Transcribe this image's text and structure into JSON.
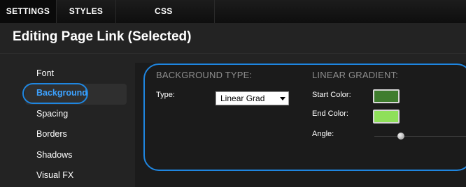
{
  "tabs": [
    {
      "label": "SETTINGS"
    },
    {
      "label": "STYLES"
    },
    {
      "label": "CSS"
    }
  ],
  "page_title": "Editing Page Link (Selected)",
  "sidebar": {
    "items": [
      {
        "label": "Font"
      },
      {
        "label": "Background"
      },
      {
        "label": "Spacing"
      },
      {
        "label": "Borders"
      },
      {
        "label": "Shadows"
      },
      {
        "label": "Visual FX"
      }
    ],
    "selected": "Background"
  },
  "background_type": {
    "heading": "BACKGROUND TYPE:",
    "type_label": "Type:",
    "type_value": "Linear Grad"
  },
  "linear_gradient": {
    "heading": "LINEAR GRADIENT:",
    "start_label": "Start Color:",
    "end_label": "End Color:",
    "angle_label": "Angle:",
    "start_color": "#3f7d2e",
    "end_color": "#8fe05a"
  },
  "colors": {
    "accent": "#1f86e0",
    "selected_text": "#3da2ff"
  },
  "icons": {
    "dropdown": "chevron-down-icon",
    "slider": "slider-knob"
  }
}
